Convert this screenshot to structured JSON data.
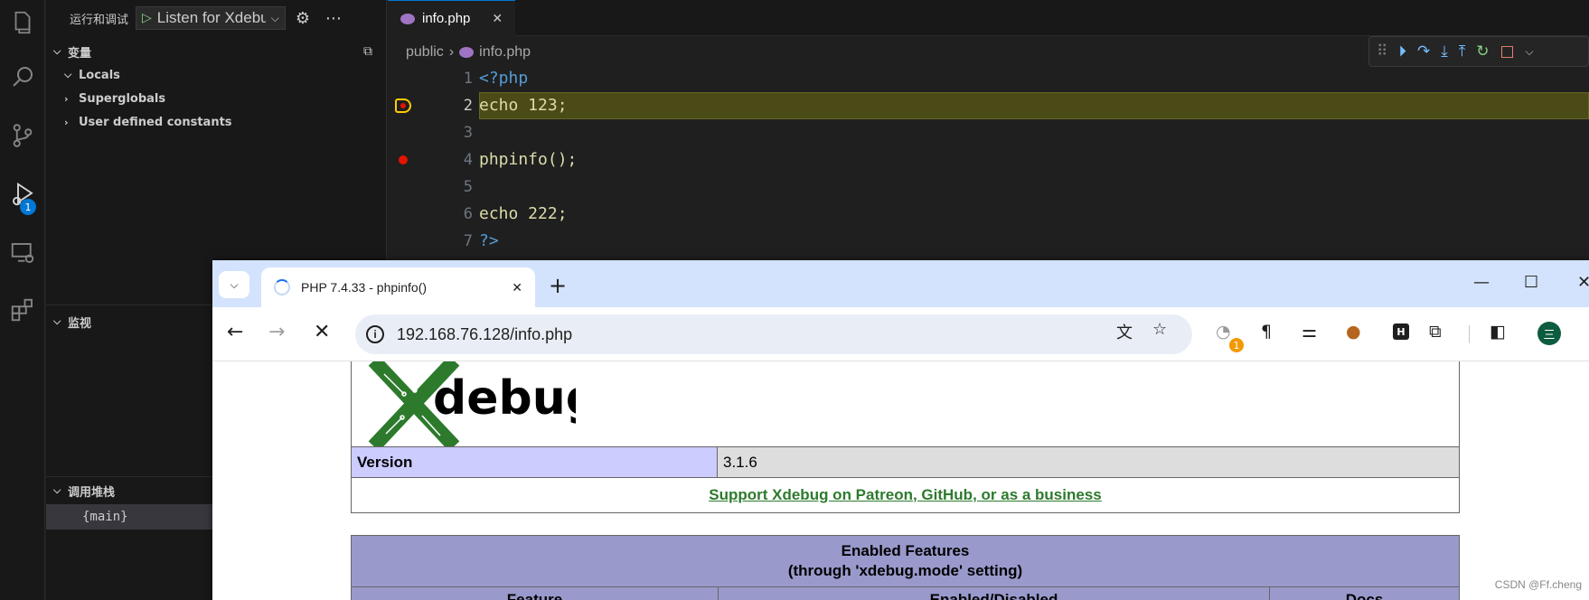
{
  "activity": {
    "debug_badge": "1"
  },
  "sidebar": {
    "title": "运行和调试",
    "config_label": "Listen for Xdebug",
    "variables": {
      "header": "变量",
      "items": [
        {
          "label": "Locals",
          "expanded": true
        },
        {
          "label": "Superglobals",
          "expanded": false
        },
        {
          "label": "User defined constants",
          "expanded": false
        }
      ]
    },
    "watch": {
      "header": "监视"
    },
    "callstack": {
      "header": "调用堆栈",
      "frames": [
        "{main}"
      ]
    }
  },
  "editor": {
    "tab": {
      "label": "info.php"
    },
    "breadcrumb": {
      "folder": "public",
      "file": "info.php"
    },
    "lines": [
      {
        "num": "1",
        "text": "<?php"
      },
      {
        "num": "2",
        "text": "echo 123;"
      },
      {
        "num": "3",
        "text": ""
      },
      {
        "num": "4",
        "text": "phpinfo();"
      },
      {
        "num": "5",
        "text": ""
      },
      {
        "num": "6",
        "text": "echo 222;"
      },
      {
        "num": "7",
        "text": "?>"
      }
    ]
  },
  "browser": {
    "tab_title": "PHP 7.4.33 - phpinfo()",
    "url": "192.168.76.128/info.php",
    "ext_badge": "1",
    "profile_initial": "三",
    "page": {
      "logo_text": "debug",
      "version_key": "Version",
      "version_value": "3.1.6",
      "support_link": "Support Xdebug on Patreon, GitHub, or as a business",
      "features_title": "Enabled Features",
      "features_subtitle": "(through 'xdebug.mode' setting)",
      "feature_cols": [
        "Feature",
        "Enabled/Disabled",
        "Docs"
      ]
    }
  },
  "watermark": "CSDN @Ff.cheng",
  "colors": {
    "accent": "#0078d4",
    "highlight": "#4b4b18",
    "breakpoint": "#e51400",
    "xdebug_green": "#2d7a2d"
  }
}
